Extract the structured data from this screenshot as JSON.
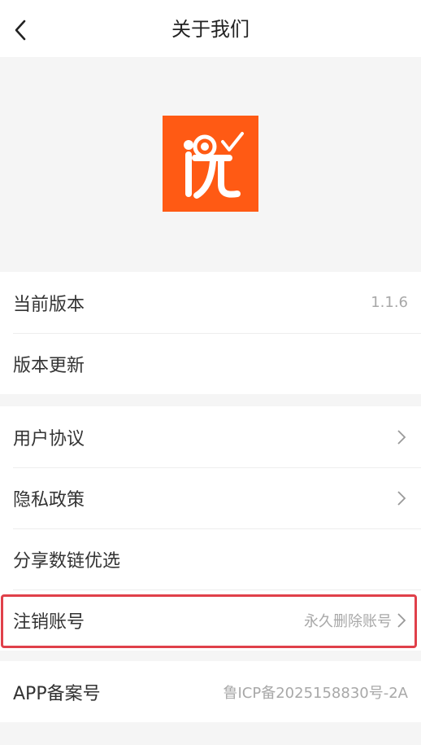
{
  "header": {
    "title": "关于我们",
    "back_icon": "chevron-left-icon"
  },
  "logo": {
    "name": "app-logo",
    "brand_color": "#ff5a14"
  },
  "group1": [
    {
      "label": "当前版本",
      "value": "1.1.6"
    },
    {
      "label": "版本更新",
      "value": ""
    }
  ],
  "group2": [
    {
      "label": "用户协议",
      "value": "",
      "icon": "chevron-right-icon"
    },
    {
      "label": "隐私政策",
      "value": "",
      "icon": "chevron-right-icon"
    },
    {
      "label": "分享数链优选",
      "value": ""
    },
    {
      "label": "注销账号",
      "value": "永久删除账号",
      "icon": "chevron-right-icon"
    }
  ],
  "group3": [
    {
      "label": "APP备案号",
      "value": "鲁ICP备2025158830号-2A"
    }
  ],
  "colors": {
    "highlight_border": "#e0404a",
    "background": "#f5f5f5"
  }
}
